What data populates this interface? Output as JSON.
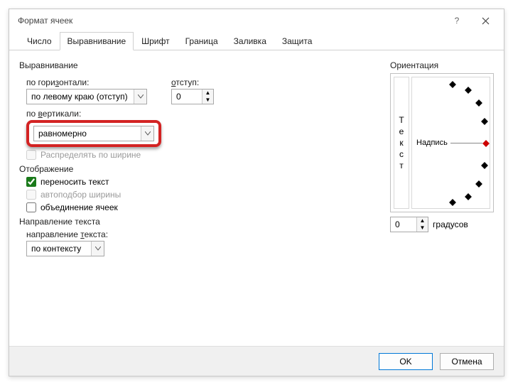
{
  "title": "Формат ячеек",
  "tabs": {
    "t0": "Число",
    "t1": "Выравнивание",
    "t2": "Шрифт",
    "t3": "Граница",
    "t4": "Заливка",
    "t5": "Защита"
  },
  "align": {
    "group": "Выравнивание",
    "horiz_label": "по горизонтали:",
    "horiz_value": "по левому краю (отступ)",
    "indent_label": "отступ:",
    "indent_value": "0",
    "vert_label": "по вертикали:",
    "vert_value": "равномерно",
    "justify_label": "Распределять по ширине"
  },
  "display": {
    "group": "Отображение",
    "wrap_label": "переносить текст",
    "shrink_label": "автоподбор ширины",
    "merge_label": "объединение ячеек"
  },
  "textdir": {
    "group": "Направление текста",
    "label": "направление текста:",
    "value": "по контексту"
  },
  "orient": {
    "group": "Ориентация",
    "vchars": {
      "c0": "Т",
      "c1": "е",
      "c2": "к",
      "c3": "с",
      "c4": "т"
    },
    "label": "Надпись",
    "deg_value": "0",
    "deg_label": "градусов"
  },
  "footer": {
    "ok": "OK",
    "cancel": "Отмена"
  }
}
